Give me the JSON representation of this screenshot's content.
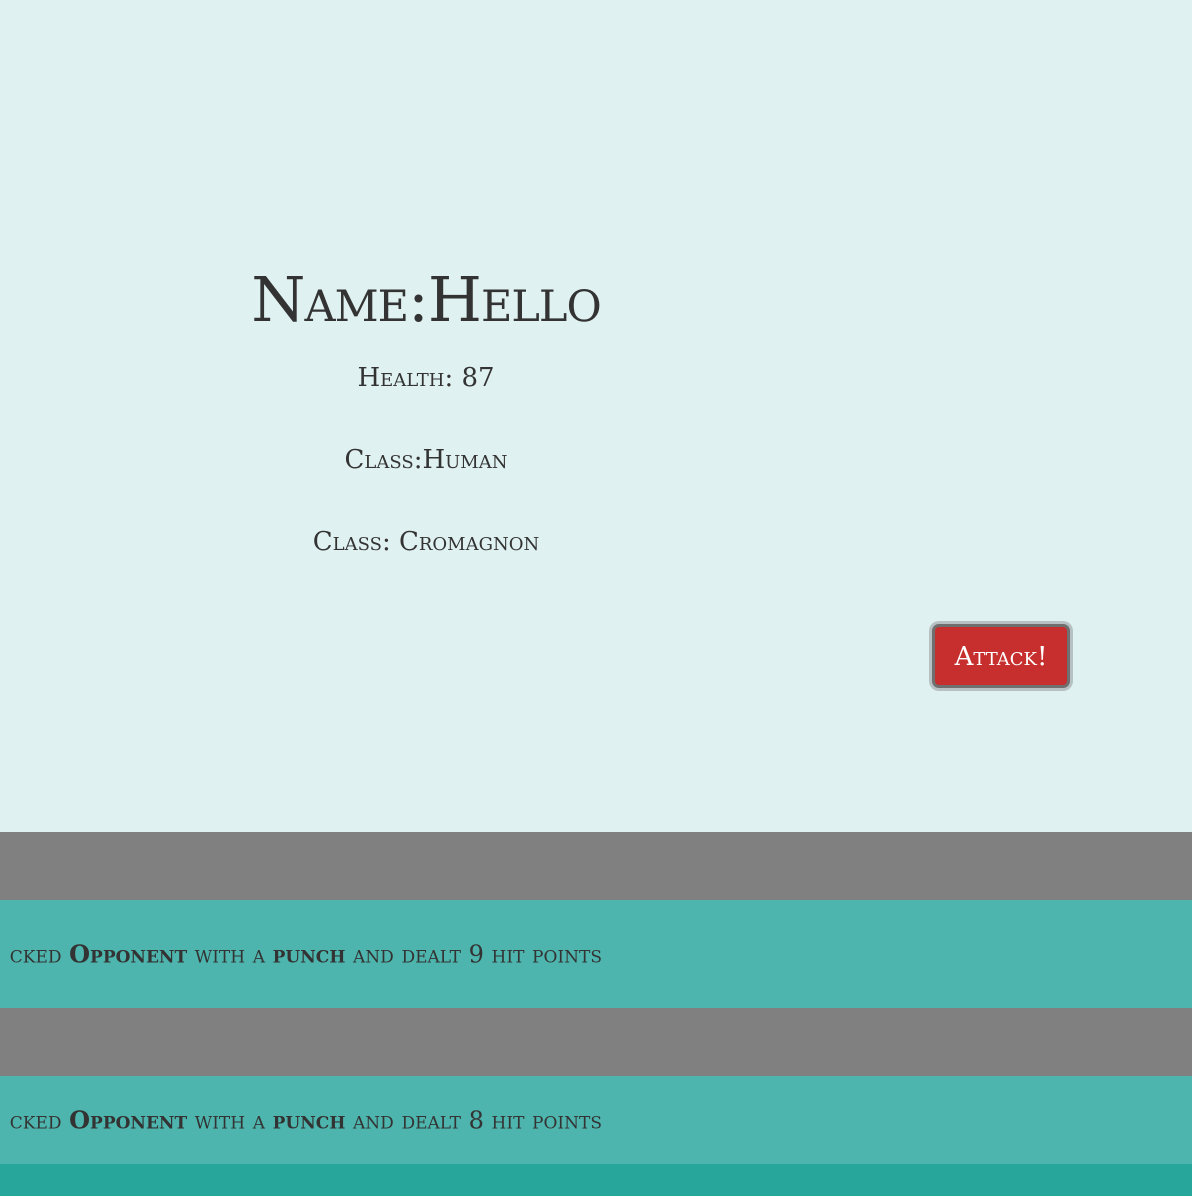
{
  "player": {
    "name_label": "Name:Hello",
    "health_label": "Health: 87",
    "class_label": "Class:Human",
    "subclass_label": "Class: Cromagnon"
  },
  "actions": {
    "attack_label": "Attack!"
  },
  "combat_log": [
    {
      "prefix": "cked",
      "target": "Opponent",
      "mid": "with a",
      "weapon": "punch",
      "tail": "and dealt 9 hit points"
    },
    {
      "prefix": "cked",
      "target": "Opponent",
      "mid": "with a",
      "weapon": "punch",
      "tail": "and dealt 8 hit points"
    }
  ],
  "colors": {
    "background": "#dff1f0",
    "log_band": "#4db5ad",
    "log_gap": "#808080",
    "attack": "#c62f2e",
    "footer": "#27a79b"
  }
}
